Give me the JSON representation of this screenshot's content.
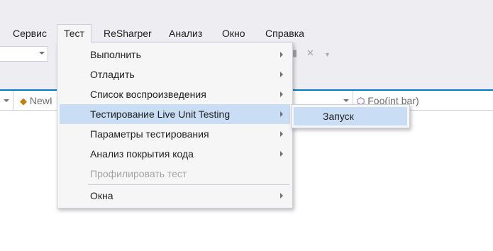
{
  "menubar": {
    "items": [
      {
        "label": "Сервис"
      },
      {
        "label": "Тест"
      },
      {
        "label": "ReSharper"
      },
      {
        "label": "Анализ"
      },
      {
        "label": "Окно"
      },
      {
        "label": "Справка"
      }
    ]
  },
  "navbar": {
    "type_selector": "NewI",
    "member_selector": "Foo(int bar)"
  },
  "test_menu": {
    "items": [
      {
        "label": "Выполнить",
        "has_submenu": true
      },
      {
        "label": "Отладить",
        "has_submenu": true
      },
      {
        "label": "Список воспроизведения",
        "has_submenu": true
      },
      {
        "label": "Тестирование Live Unit Testing",
        "has_submenu": true,
        "highlighted": true
      },
      {
        "label": "Параметры тестирования",
        "has_submenu": true
      },
      {
        "label": "Анализ покрытия кода",
        "has_submenu": true
      },
      {
        "label": "Профилировать тест",
        "enabled": false
      },
      {
        "label": "Окна",
        "has_submenu": true
      }
    ]
  },
  "live_unit_submenu": {
    "items": [
      {
        "label": "Запуск",
        "highlighted": true
      }
    ]
  },
  "colors": {
    "chrome": "#eeeef2",
    "accent": "#007acc",
    "highlight": "#c9def5",
    "menu_bg": "#f6f6f6"
  }
}
